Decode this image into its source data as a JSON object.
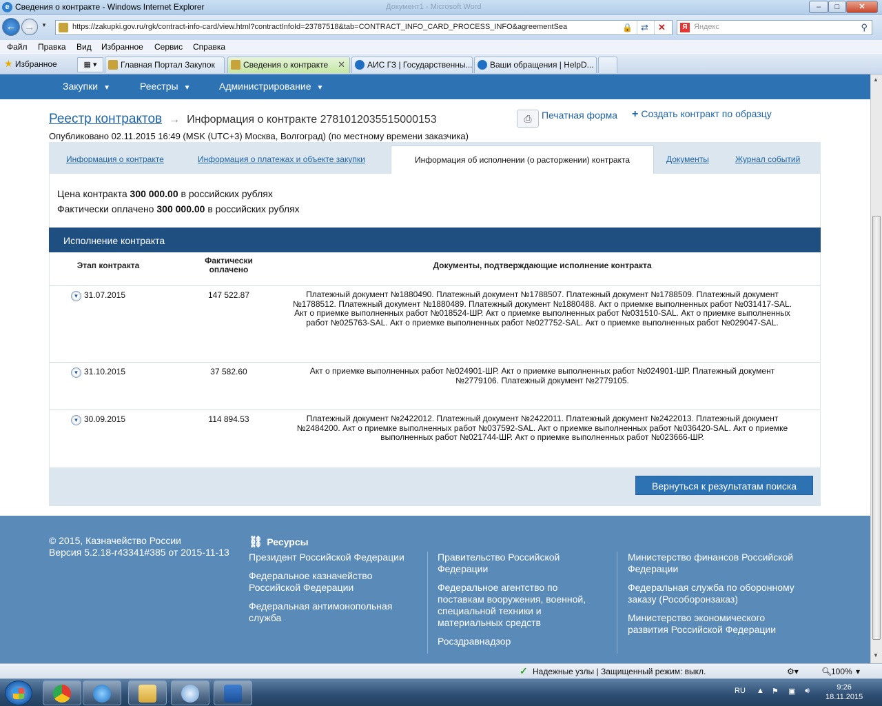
{
  "window": {
    "title": "Сведения о контракте - Windows Internet Explorer",
    "ghost_title": "Документ1 - Microsoft Word",
    "min": "–",
    "max": "□",
    "close": "✕"
  },
  "address": {
    "url": "https://zakupki.gov.ru/rgk/contract-info-card/view.html?contractInfoId=23787518&tab=CONTRACT_INFO_CARD_PROCESS_INFO&agreementSea",
    "search_placeholder": "Яндекс",
    "search_brand": "Я"
  },
  "menu": [
    "Файл",
    "Правка",
    "Вид",
    "Избранное",
    "Сервис",
    "Справка"
  ],
  "favorites_label": "Избранное",
  "browser_tabs": [
    {
      "label": "Главная Портал Закупок",
      "color": "#c8a33a",
      "active": false
    },
    {
      "label": "Сведения о контракте",
      "color": "#c8a33a",
      "active": true
    },
    {
      "label": "АИС ГЗ | Государственны...",
      "color": "#1f6fc5",
      "active": false
    },
    {
      "label": "Ваши обращения | HelpD...",
      "color": "#1f6fc5",
      "active": false
    }
  ],
  "portal_nav": [
    "Закупки",
    "Реестры",
    "Администрирование"
  ],
  "breadcrumb": {
    "registry": "Реестр контрактов",
    "arrow": "→",
    "info": "Информация о контракте 2781012035515000153"
  },
  "actions": {
    "print": "Печатная форма",
    "create_plus": "+",
    "create": "Создать контракт по образцу"
  },
  "published": "Опубликовано 02.11.2015 16:49 (MSK (UTC+3) Москва, Волгоград) (по местному времени заказчика)",
  "page_tabs": {
    "t1": "Информация о контракте",
    "t2": "Информация о платежах и объекте закупки",
    "active": "Информация об исполнении (о расторжении) контракта",
    "t4": "Документы",
    "t5": "Журнал событий"
  },
  "summary": {
    "price_prefix": "Цена контракта ",
    "price_value": "300 000.00",
    "price_suffix": " в российских рублях",
    "paid_prefix": "Фактически оплачено ",
    "paid_value": "300 000.00",
    "paid_suffix": " в российских рублях"
  },
  "execution": {
    "title": "Исполнение контракта",
    "headers": {
      "stage": "Этап контракта",
      "paid_line1": "Фактически",
      "paid_line2": "оплачено",
      "docs": "Документы, подтверждающие исполнение контракта"
    },
    "rows": [
      {
        "date": "31.07.2015",
        "amount": "147 522.87",
        "docs": "Платежный документ №1880490. Платежный документ №1788507. Платежный документ №1788509. Платежный документ №1788512. Платежный документ №1880489. Платежный документ №1880488. Акт о приемке выполненных работ №031417-SAL. Акт о приемке выполненных работ №018524-ШР. Акт о приемке выполненных работ №031510-SAL. Акт о приемке выполненных работ №025763-SAL. Акт о приемке выполненных работ №027752-SAL. Акт о приемке выполненных работ №029047-SAL."
      },
      {
        "date": "31.10.2015",
        "amount": "37 582.60",
        "docs": "Акт о приемке выполненных работ №024901-ШР. Акт о приемке выполненных работ №024901-ШР. Платежный документ №2779106. Платежный документ №2779105."
      },
      {
        "date": "30.09.2015",
        "amount": "114 894.53",
        "docs": "Платежный документ №2422012. Платежный документ №2422011. Платежный документ №2422013. Платежный документ №2484200. Акт о приемке выполненных работ №037592-SAL. Акт о приемке выполненных работ №036420-SAL. Акт о приемке выполненных работ №021744-ШР. Акт о приемке выполненных работ №023666-ШР."
      }
    ],
    "back_button": "Вернуться к результатам поиска"
  },
  "footer": {
    "copyright": "© 2015, Казначейство России",
    "version": "Версия 5.2.18-r43341#385 от 2015-11-13",
    "resources_title": "Ресурсы",
    "col1": [
      "Президент Российской Федерации",
      "Федеральное казначейство Российской Федерации",
      "Федеральная антимонопольная служба"
    ],
    "col2": [
      "Правительство Российской Федерации",
      "Федеральное агентство по поставкам вооружения, военной, специальной техники и материальных средств",
      "Росздравнадзор"
    ],
    "col3": [
      "Министерство финансов Российской Федерации",
      "Федеральная служба по оборонному заказу (Рособоронзаказ)",
      "Министерство экономического развития Российской Федерации"
    ]
  },
  "status": {
    "zone": "Надежные узлы | Защищенный режим: выкл.",
    "zoom": "100%"
  },
  "taskbar": {
    "lang": "RU",
    "time": "9:26",
    "date": "18.11.2015"
  }
}
